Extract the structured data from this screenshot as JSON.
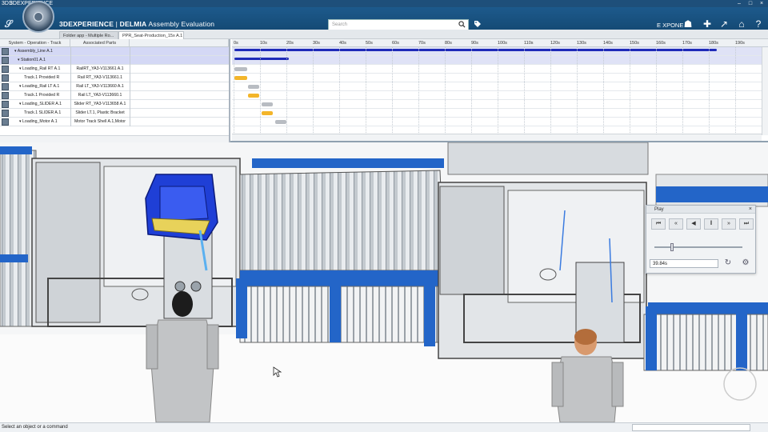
{
  "window": {
    "title": "3DEXPERIENCE",
    "logo": "3DS"
  },
  "app": {
    "brand": "3DEXPERIENCE",
    "separator": "|",
    "product": "DELMIA",
    "module": "Assembly Evaluation"
  },
  "search": {
    "placeholder": "Search"
  },
  "user": {
    "name": "E XPONE"
  },
  "tabs": [
    {
      "label": "Folder app - Multiple Ro..."
    },
    {
      "label": "PPR_Seat-Production_15x A.1"
    }
  ],
  "gantt": {
    "columns": [
      "System - Operation - Track",
      "Associated Parts"
    ],
    "rows": [
      {
        "name": "▾ Assembly_Line A.1",
        "parts": ""
      },
      {
        "name": "▾ Station01 A.1",
        "parts": ""
      },
      {
        "name": "▾ Loading_Rail RT A.1",
        "parts": "RailRT_YA3-V113661 A.1"
      },
      {
        "name": "Track.1  Provided R",
        "parts": "Rail RT_YA3-V113661.1"
      },
      {
        "name": "▾ Loading_Rail LT A.1",
        "parts": "Rail LT_YA3-V113660 A.1"
      },
      {
        "name": "Track.1  Provided R",
        "parts": "Rail LT_YA3-V113660.1"
      },
      {
        "name": "▾ Loading_SLIDER A.1",
        "parts": "Slider RT_YA3-V113658 A.1"
      },
      {
        "name": "Track.1  SLIDER A.1",
        "parts": "Slider  LT.1, Plastic Bracket"
      },
      {
        "name": "▾ Loading_Motor A.1",
        "parts": "Motor Track Shell A.1,Motor"
      }
    ],
    "ticks": [
      "0s",
      "10s",
      "20s",
      "30s",
      "40s",
      "50s",
      "60s",
      "70s",
      "80s",
      "90s",
      "100s",
      "110s",
      "120s",
      "130s",
      "140s",
      "150s",
      "160s",
      "170s",
      "180s",
      "190s"
    ]
  },
  "player": {
    "title": "Play",
    "close": "×",
    "buttons": [
      {
        "name": "skip-to-start",
        "glyph": "⏮"
      },
      {
        "name": "step-back",
        "glyph": "«"
      },
      {
        "name": "play-backward",
        "glyph": "◀"
      },
      {
        "name": "pause",
        "glyph": "‖"
      },
      {
        "name": "step-forward",
        "glyph": "»"
      },
      {
        "name": "skip-to-end",
        "glyph": "⏭"
      }
    ],
    "time": "39.84s",
    "progress": 0.18
  },
  "status": {
    "text": "Select an object or a command"
  },
  "colors": {
    "accent": "#1d5a8c",
    "bar_blue": "#1f2bb8",
    "bar_gold": "#f3b52a",
    "bar_grey": "#b8bcc2",
    "conveyor_blue": "#2365c8"
  }
}
